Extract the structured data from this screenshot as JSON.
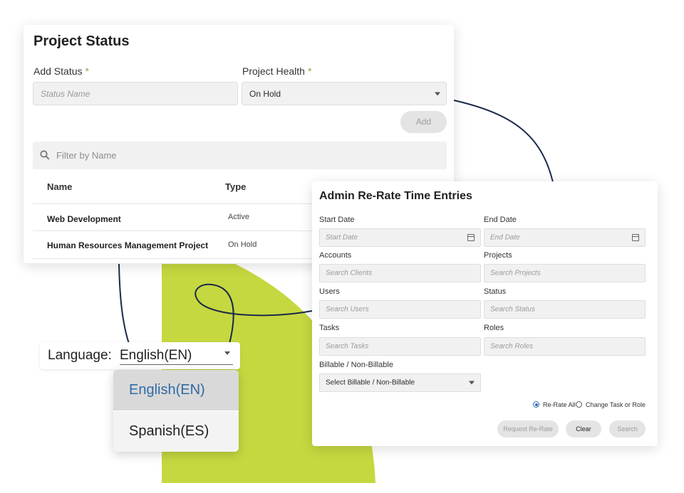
{
  "project_status": {
    "title": "Project Status",
    "add_status_label": "Add Status",
    "project_health_label": "Project Health",
    "required_mark": "*",
    "status_name_placeholder": "Status Name",
    "project_health_value": "On Hold",
    "add_button": "Add",
    "filter_placeholder": "Filter by Name",
    "columns": [
      "Name",
      "Type"
    ],
    "rows": [
      {
        "name": "Web Development",
        "type": "Active"
      },
      {
        "name": "Human Resources Management Project",
        "type": "On Hold"
      }
    ]
  },
  "admin_rerate": {
    "title": "Admin Re-Rate Time Entries",
    "start_date_label": "Start Date",
    "start_date_placeholder": "Start Date",
    "end_date_label": "End Date",
    "end_date_placeholder": "End Date",
    "accounts_label": "Accounts",
    "accounts_placeholder": "Search Clients",
    "projects_label": "Projects",
    "projects_placeholder": "Search Projects",
    "users_label": "Users",
    "users_placeholder": "Search Users",
    "status_label": "Status",
    "status_placeholder": "Search Status",
    "tasks_label": "Tasks",
    "tasks_placeholder": "Search Tasks",
    "roles_label": "Roles",
    "roles_placeholder": "Search Roles",
    "billable_label": "Billable / Non-Billable",
    "billable_value": "Select Billable / Non-Billable",
    "radio_rerate_all": "Re-Rate All",
    "radio_change_task": "Change Task or Role",
    "request_button": "Request Re-Rate",
    "clear_button": "Clear",
    "search_button": "Search"
  },
  "language": {
    "label": "Language:",
    "value": "English(EN)",
    "options": [
      "English(EN)",
      "Spanish(ES)"
    ]
  },
  "colors": {
    "accent_green": "#c6d840",
    "curve": "#1b2a4a",
    "link_blue": "#2f6aa6"
  }
}
